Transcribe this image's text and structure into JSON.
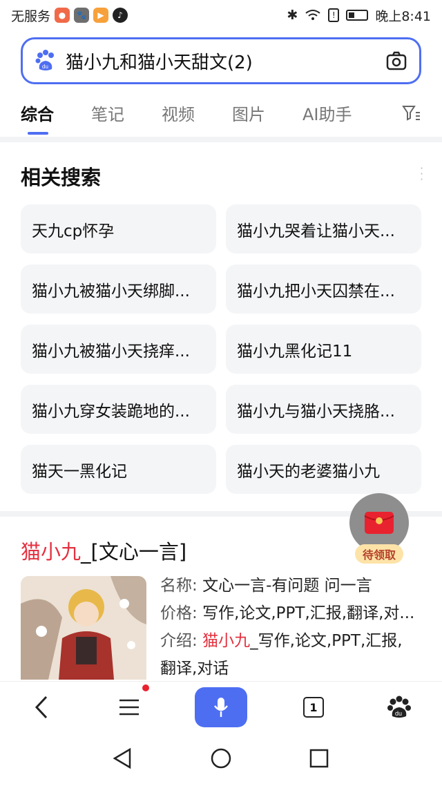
{
  "status": {
    "carrier": "无服务",
    "time": "晚上8:41"
  },
  "search": {
    "query": "猫小九和猫小天甜文(2)"
  },
  "tabs": [
    {
      "label": "综合",
      "active": true
    },
    {
      "label": "笔记"
    },
    {
      "label": "视频"
    },
    {
      "label": "图片"
    },
    {
      "label": "AI助手"
    }
  ],
  "related": {
    "title": "相关搜索",
    "items": [
      "天九cp怀孕",
      "猫小九哭着让猫小天...",
      "猫小九被猫小天绑脚...",
      "猫小九把小天囚禁在...",
      "猫小九被猫小天挠痒...",
      "猫小九黑化记11",
      "猫小九穿女装跪地的...",
      "猫小九与猫小天挠胳...",
      "猫天一黑化记",
      "猫小天的老婆猫小九"
    ]
  },
  "result": {
    "title_hl": "猫小九",
    "title_rest": "_[文心一言]",
    "rows": {
      "name_k": "名称:",
      "name_v": "文心一言-有问题 问一言",
      "price_k": "价格:",
      "price_v": "写作,论文,PPT,汇报,翻译,对...",
      "intro_k": "介绍:",
      "intro_hl": "猫小九",
      "intro_v": "_写作,论文,PPT,汇报,",
      "intro_v2": "翻译,对话"
    }
  },
  "floating": {
    "label": "待领取"
  },
  "bottombar": {
    "tab_count": "1"
  },
  "colors": {
    "accent": "#4e6ef2",
    "highlight": "#e3313f",
    "chip_bg": "#f4f5f7"
  }
}
